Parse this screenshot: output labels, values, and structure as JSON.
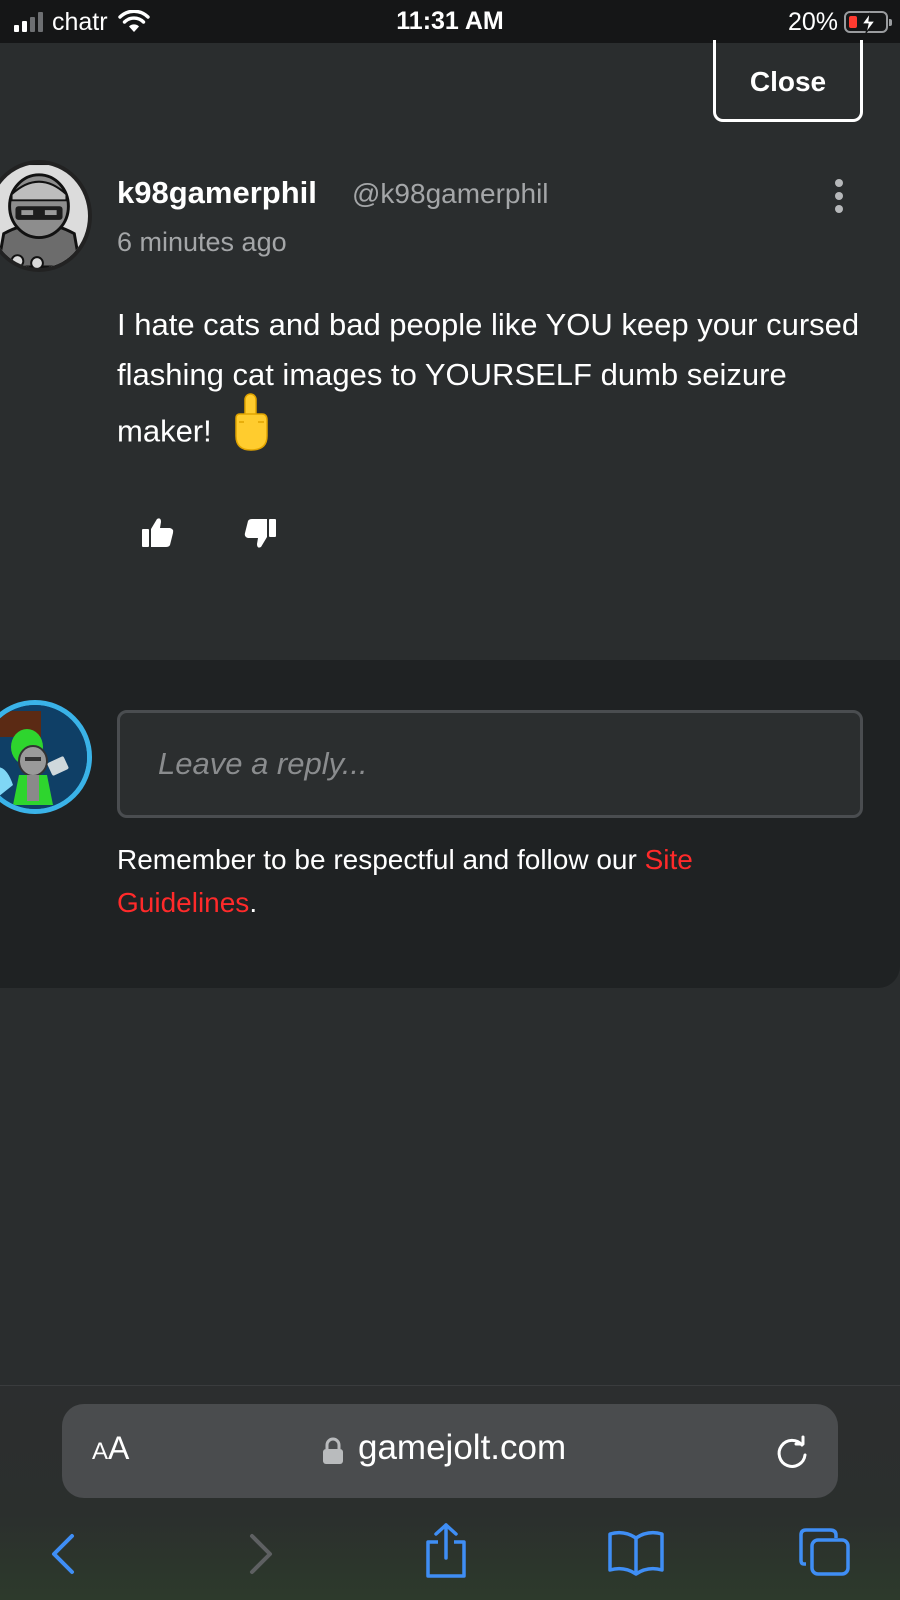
{
  "status_bar": {
    "carrier": "chatr",
    "time": "11:31 AM",
    "battery_percent": "20%",
    "battery_level": 0.2,
    "signal_bars": 2,
    "icons": [
      "signal-icon",
      "wifi-icon",
      "battery-charging-icon"
    ]
  },
  "modal": {
    "close_label": "Close"
  },
  "post": {
    "username": "k98gamerphil",
    "handle": "@k98gamerphil",
    "time_ago": "6 minutes ago",
    "body": "I hate cats and bad people like YOU keep your cursed flashing cat images to YOURSELF dumb seizure maker!",
    "emoji": "🖕",
    "actions": [
      "thumbs-up-icon",
      "thumbs-down-icon",
      "more-options-icon"
    ]
  },
  "reply": {
    "placeholder": "Leave a reply...",
    "guidelines_text": "Remember to be respectful and follow our ",
    "guidelines_link": "Site Guidelines",
    "guidelines_end": "."
  },
  "browser": {
    "text_size_small": "A",
    "text_size_large": "A",
    "url": "gamejolt.com",
    "nav_icons": [
      "back-icon",
      "forward-icon",
      "share-icon",
      "bookmarks-icon",
      "tabs-icon"
    ]
  },
  "colors": {
    "background": "#2a2d2e",
    "panel": "#1f2223",
    "link": "#ff2a2a",
    "ios_blue": "#3f8ef5",
    "muted_text": "#a4a6a8"
  }
}
